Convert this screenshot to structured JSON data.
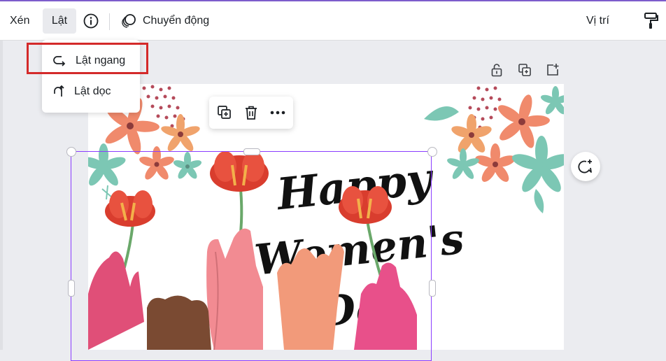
{
  "toolbar": {
    "crop_label": "Xén",
    "flip_label": "Lật",
    "animate_label": "Chuyển động",
    "position_label": "Vị trí"
  },
  "flip_menu": {
    "items": [
      {
        "label": "Lật ngang",
        "icon": "flip-horizontal-icon"
      },
      {
        "label": "Lật dọc",
        "icon": "flip-vertical-icon"
      }
    ]
  },
  "page_actions": [
    "lock-icon",
    "duplicate-page-icon",
    "add-page-icon"
  ],
  "element_actions": [
    "duplicate-icon",
    "trash-icon",
    "more-icon"
  ],
  "design": {
    "headline_lines": [
      "Happy",
      "Women's",
      "Day"
    ]
  },
  "colors": {
    "accent": "#8b3dff",
    "highlight": "#d42a2a",
    "flower_red": "#d93d2e",
    "flower_peach": "#f08a6c",
    "leaf_teal": "#7cc7b4"
  }
}
